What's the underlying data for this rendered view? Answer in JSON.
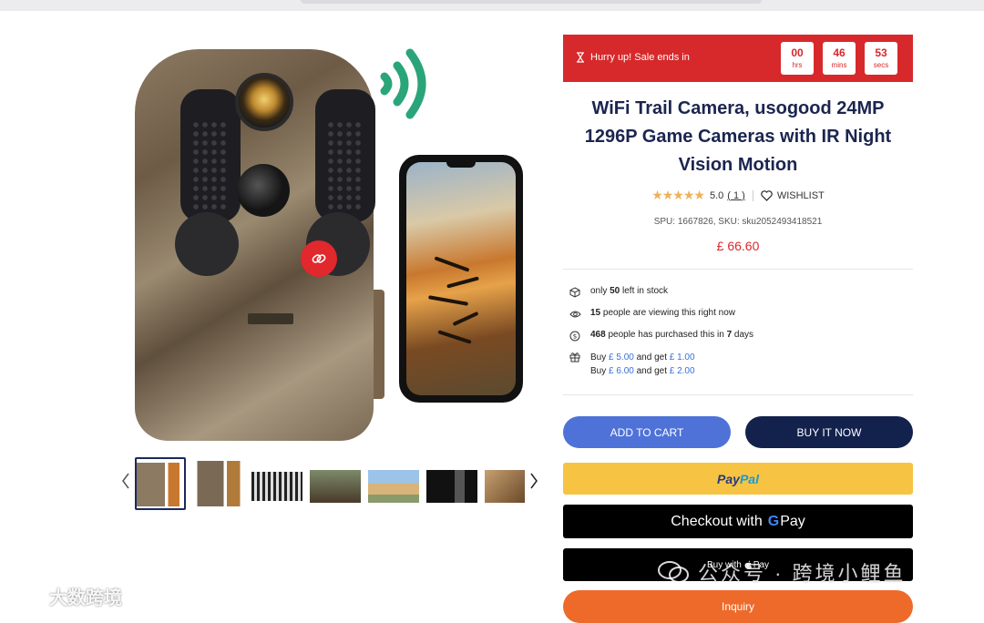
{
  "sale": {
    "text": "Hurry up!  Sale ends in",
    "countdown": [
      {
        "value": "00",
        "unit": "hrs"
      },
      {
        "value": "46",
        "unit": "mins"
      },
      {
        "value": "53",
        "unit": "secs"
      }
    ],
    "color": "#d7292b"
  },
  "product": {
    "title": "WiFi Trail Camera, usogood 24MP 1296P Game Cameras with IR Night Vision Motion",
    "rating": "5.0",
    "review_count": "( 1 )",
    "wishlist_label": "WISHLIST",
    "sku_line": "SPU: 1667826, SKU: sku2052493418521",
    "price": "£ 66.60"
  },
  "info": {
    "stock": {
      "pre": "only ",
      "count": "50",
      "post": " left in stock"
    },
    "viewing": {
      "count": "15",
      "post": " people are viewing this right now"
    },
    "purchased": {
      "count": "468",
      "mid": " people has purchased this in ",
      "days": "7",
      "post": " days"
    },
    "promos": [
      {
        "pre": "Buy ",
        "spend": "£ 5.00",
        "mid": " and get ",
        "get": "£ 1.00"
      },
      {
        "pre": "Buy ",
        "spend": "£ 6.00",
        "mid": " and get ",
        "get": "£ 2.00"
      }
    ]
  },
  "buttons": {
    "add_to_cart": "ADD TO CART",
    "buy_now": "BUY IT NOW",
    "paypal_pay": "Pay",
    "paypal_pal": "Pal",
    "gpay_prefix": "Checkout with",
    "gpay_suffix": "Pay",
    "applepay_prefix": "Buy with",
    "applepay_suffix": "Pay",
    "inquiry": "Inquiry"
  },
  "gallery": {
    "thumbnails": 7,
    "selected_index": 0
  },
  "watermarks": {
    "right": "公众号 · 跨境小鲤鱼",
    "left": "大数跨境"
  },
  "colors": {
    "brand_navy": "#1b2550",
    "cart_blue": "#4f72d8",
    "paypal_yellow": "#f6c343",
    "inquiry_orange": "#ee6a2a",
    "star": "#f0b05a"
  }
}
